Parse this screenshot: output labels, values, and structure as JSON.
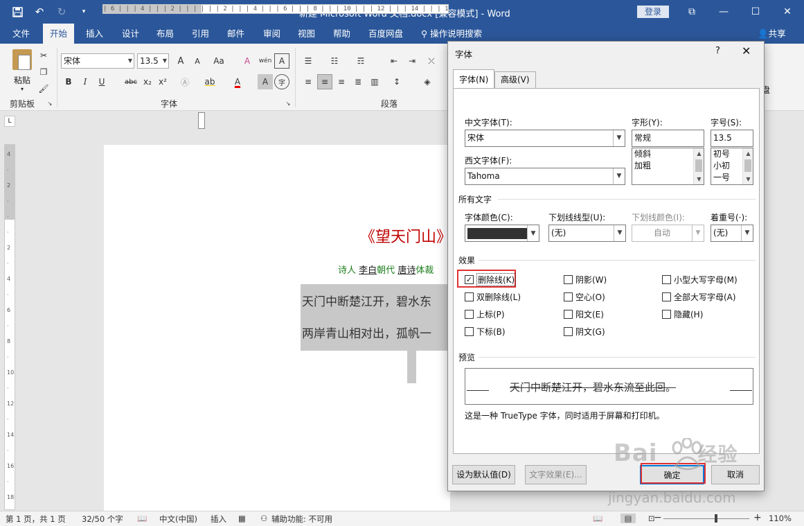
{
  "window": {
    "title": "新建 Microsoft Word 文档.docx [兼容模式]  -  Word",
    "login_label": "登录",
    "controls": [
      "⧉",
      "—",
      "☐",
      "✕"
    ]
  },
  "ribbon_tabs": [
    "文件",
    "开始",
    "插入",
    "设计",
    "布局",
    "引用",
    "邮件",
    "审阅",
    "视图",
    "帮助",
    "百度网盘"
  ],
  "tell_me": "操作说明搜索",
  "share_label": "共享",
  "ribbon": {
    "paste_label": "粘贴",
    "clipboard_label": "剪贴板",
    "font_group_label": "字体",
    "paragraph_group_label": "段落",
    "font_name": "宋体",
    "font_size": "13.5",
    "bold": "B",
    "italic": "I",
    "underline": "U",
    "strike": "abc",
    "subscript": "x₂",
    "superscript": "x²",
    "grow": "A",
    "shrink": "A",
    "case": "Aa",
    "clear_format": "A",
    "pinyin": "wén",
    "border_char": "A",
    "font_color_glyph": "A",
    "highlight_glyph": "ab",
    "shade_glyph": "A",
    "circle_glyph": "字",
    "right_fragment_1": "J",
    "right_fragment_2": "盘"
  },
  "ruler": {
    "corner": "L",
    "top_text": "| 6 | | | 4 | | | 2 | | | | | | 2 | | | 4 | | | 6 | | | 8 | | | 10 | | | 12 | | | 14 | | | 16 | | | 18 | | | 20 | | | 22 | |",
    "left_marks": [
      "4",
      "",
      "2",
      "",
      "",
      "",
      "2",
      "",
      "4",
      "",
      "6",
      "",
      "8",
      "",
      "10",
      "",
      "12",
      "",
      "14",
      "",
      "16",
      "",
      "18"
    ]
  },
  "document": {
    "title": "《望天门山》",
    "meta_1": "诗人",
    "meta_poet": "李白",
    "meta_2": "朝代",
    "meta_dynasty": "唐诗",
    "meta_3": "体裁",
    "line_1": "天门中断楚江开，碧水东",
    "line_2": "两岸青山相对出，孤帆一"
  },
  "status": {
    "page": "第 1 页，共 1 页",
    "words": "32/50 个字",
    "language": "中文(中国)",
    "mode": "插入",
    "accessibility": "辅助功能: 不可用",
    "zoom": "110%",
    "zoom_level_percent": 110
  },
  "dialog": {
    "title": "字体",
    "help": "?",
    "close": "✕",
    "tab_font": "字体(N)",
    "tab_advanced": "高级(V)",
    "cn_font_label": "中文字体(T):",
    "cn_font_value": "宋体",
    "west_font_label": "西文字体(F):",
    "west_font_value": "Tahoma",
    "style_label": "字形(Y):",
    "style_value": "常规",
    "style_options": [
      "常规",
      "倾斜",
      "加粗"
    ],
    "size_label": "字号(S):",
    "size_value": "13.5",
    "size_options": [
      "初号",
      "小初",
      "一号"
    ],
    "all_text_label": "所有文字",
    "font_color_label": "字体颜色(C):",
    "underline_style_label": "下划线线型(U):",
    "underline_style_value": "(无)",
    "underline_color_label": "下划线颜色(I):",
    "underline_color_value": "自动",
    "emphasis_label": "着重号(·):",
    "emphasis_value": "(无)",
    "effects_label": "效果",
    "effects": [
      {
        "label": "删除线(K)",
        "checked": true
      },
      {
        "label": "双删除线(L)",
        "checked": false
      },
      {
        "label": "上标(P)",
        "checked": false
      },
      {
        "label": "下标(B)",
        "checked": false
      },
      {
        "label": "阴影(W)",
        "checked": false
      },
      {
        "label": "空心(O)",
        "checked": false
      },
      {
        "label": "阳文(E)",
        "checked": false
      },
      {
        "label": "阴文(G)",
        "checked": false
      },
      {
        "label": "小型大写字母(M)",
        "checked": false
      },
      {
        "label": "全部大写字母(A)",
        "checked": false
      },
      {
        "label": "隐藏(H)",
        "checked": false
      }
    ],
    "preview_label": "预览",
    "preview_text": "天门中断楚江开，碧水东流至此回。",
    "truetype_note": "这是一种 TrueType 字体，同时适用于屏幕和打印机。",
    "set_default": "设为默认值(D)",
    "text_effects": "文字效果(E)...",
    "ok": "确定",
    "cancel": "取消",
    "font_color_hex": "#333333",
    "highlight_color_hex": "#e03030"
  },
  "watermark": {
    "brand": "Bai",
    "brand2": "经验",
    "url": "jingyan.baidu.com"
  }
}
